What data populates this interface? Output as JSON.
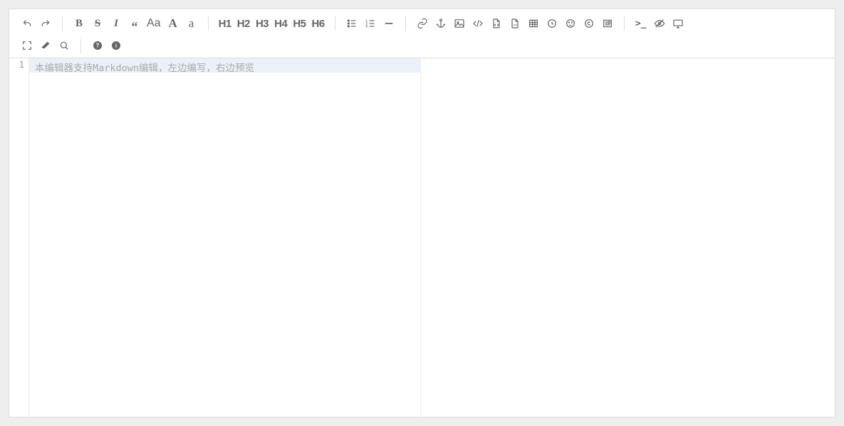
{
  "toolbar": {
    "undo": "undo",
    "redo": "redo",
    "bold": "B",
    "strike": "S",
    "italic": "I",
    "quote": "“",
    "textcase": "Aa",
    "uppercase_a": "A",
    "lowercase_a": "a",
    "h1": "H1",
    "h2": "H2",
    "h3": "H3",
    "h4": "H4",
    "h5": "H5",
    "h6": "H6",
    "terminal": ">_"
  },
  "editor": {
    "line_number": "1",
    "placeholder": "本编辑器支持Markdown编辑，左边编写，右边预览",
    "content": ""
  },
  "icons": {
    "fullscreen": "fullscreen",
    "eraser": "eraser",
    "search": "search",
    "help": "help",
    "info": "info"
  }
}
